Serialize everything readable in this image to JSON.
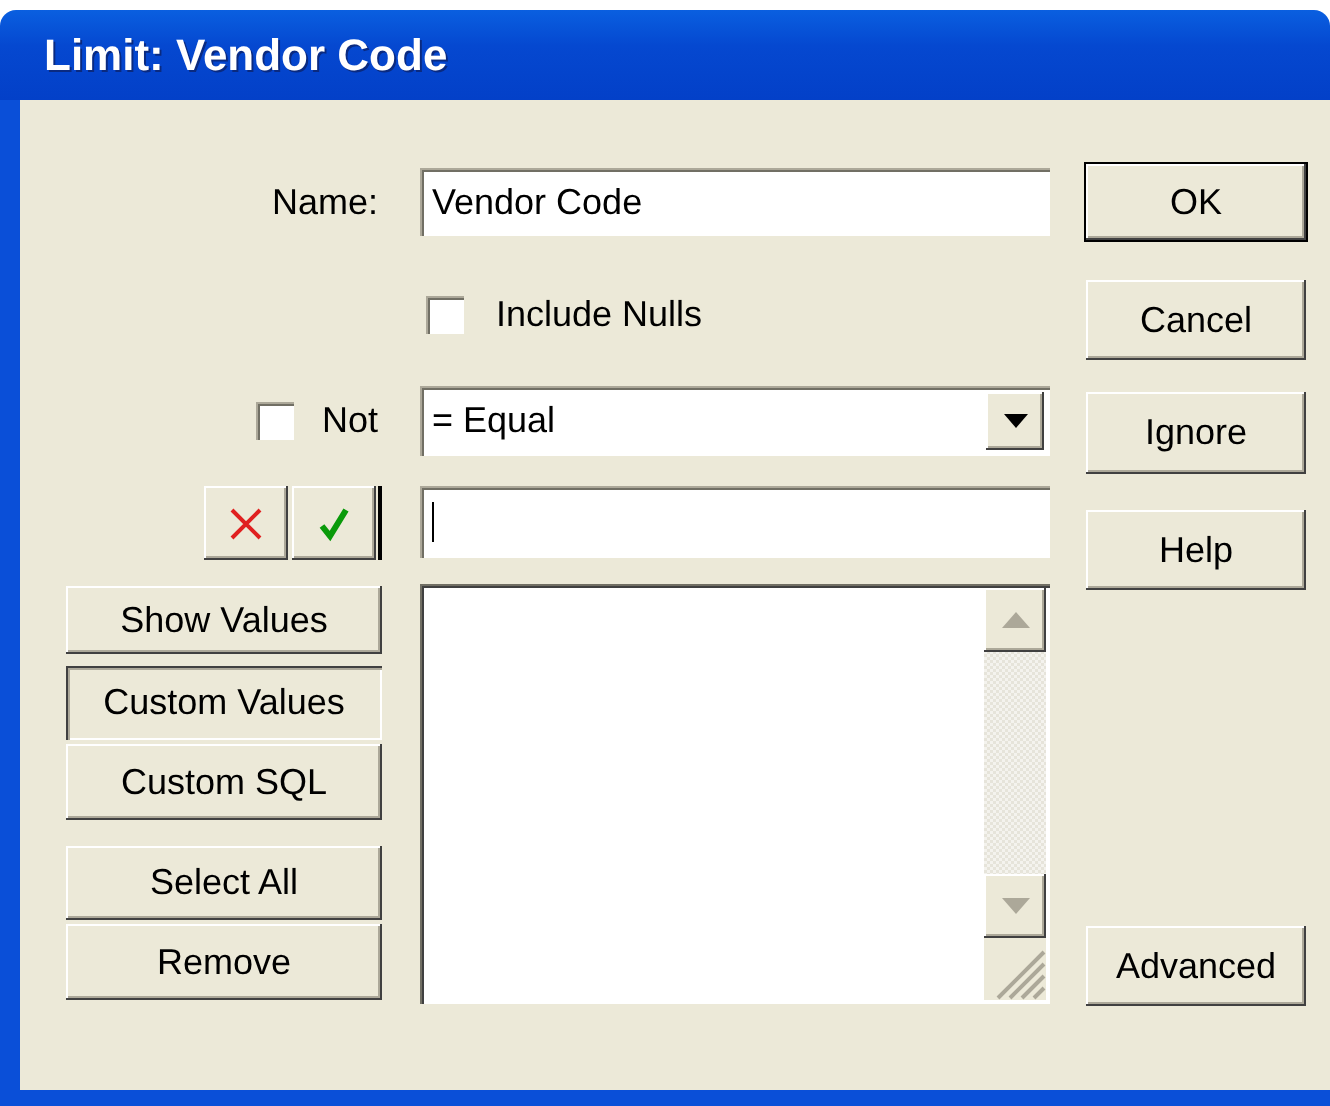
{
  "window": {
    "title": "Limit: Vendor Code"
  },
  "name_field": {
    "label": "Name:",
    "value": "Vendor Code"
  },
  "include_nulls": {
    "label": "Include Nulls",
    "checked": false
  },
  "not_option": {
    "label": "Not",
    "checked": false
  },
  "operator": {
    "value": "= Equal"
  },
  "value_field": {
    "focused": true
  },
  "mode_buttons": [
    {
      "label": "Show Values",
      "selected": false
    },
    {
      "label": "Custom Values",
      "selected": true
    },
    {
      "label": "Custom SQL",
      "selected": false
    }
  ],
  "list_buttons": [
    "Select All",
    "Remove"
  ],
  "buttons": [
    {
      "label": "OK",
      "default": true
    },
    {
      "label": "Cancel",
      "default": false
    },
    {
      "label": "Ignore",
      "default": false
    },
    {
      "label": "Help",
      "default": false
    },
    {
      "label": "Advanced",
      "default": false
    }
  ]
}
